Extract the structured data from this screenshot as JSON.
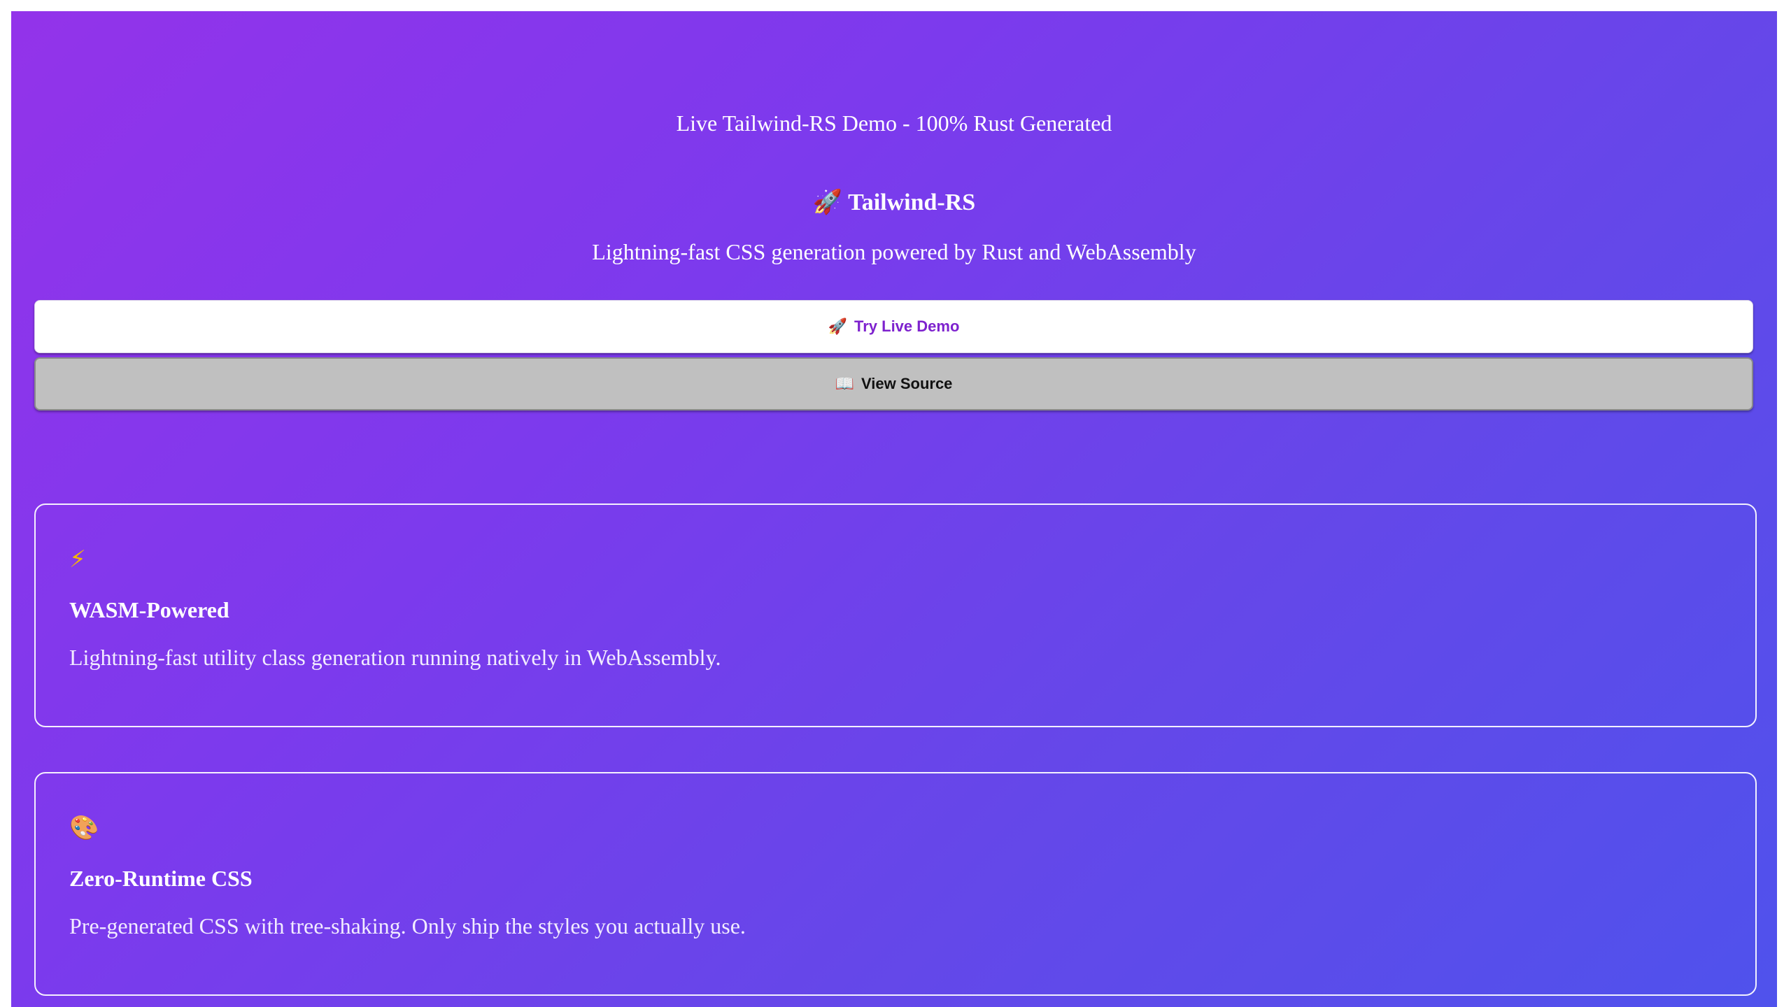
{
  "header": {
    "tagline": "Live Tailwind-RS Demo - 100% Rust Generated",
    "brand_icon": "🚀",
    "brand_name": "Tailwind-RS",
    "subtitle": "Lightning-fast CSS generation powered by Rust and WebAssembly"
  },
  "actions": {
    "demo_icon": "🚀",
    "demo_label": "Try Live Demo",
    "source_icon": "📖",
    "source_label": "View Source"
  },
  "features": [
    {
      "icon": "⚡",
      "icon_name": "lightning-icon",
      "title": "WASM-Powered",
      "text": "Lightning-fast utility class generation running natively in WebAssembly."
    },
    {
      "icon": "🎨",
      "icon_name": "palette-icon",
      "title": "Zero-Runtime CSS",
      "text": "Pre-generated CSS with tree-shaking. Only ship the styles you actually use."
    }
  ],
  "colors": {
    "gradient_start": "#9333ea",
    "gradient_end": "#4f52ec",
    "primary_button_text": "#7e22ce",
    "secondary_button_bg": "#c0c0c0"
  }
}
